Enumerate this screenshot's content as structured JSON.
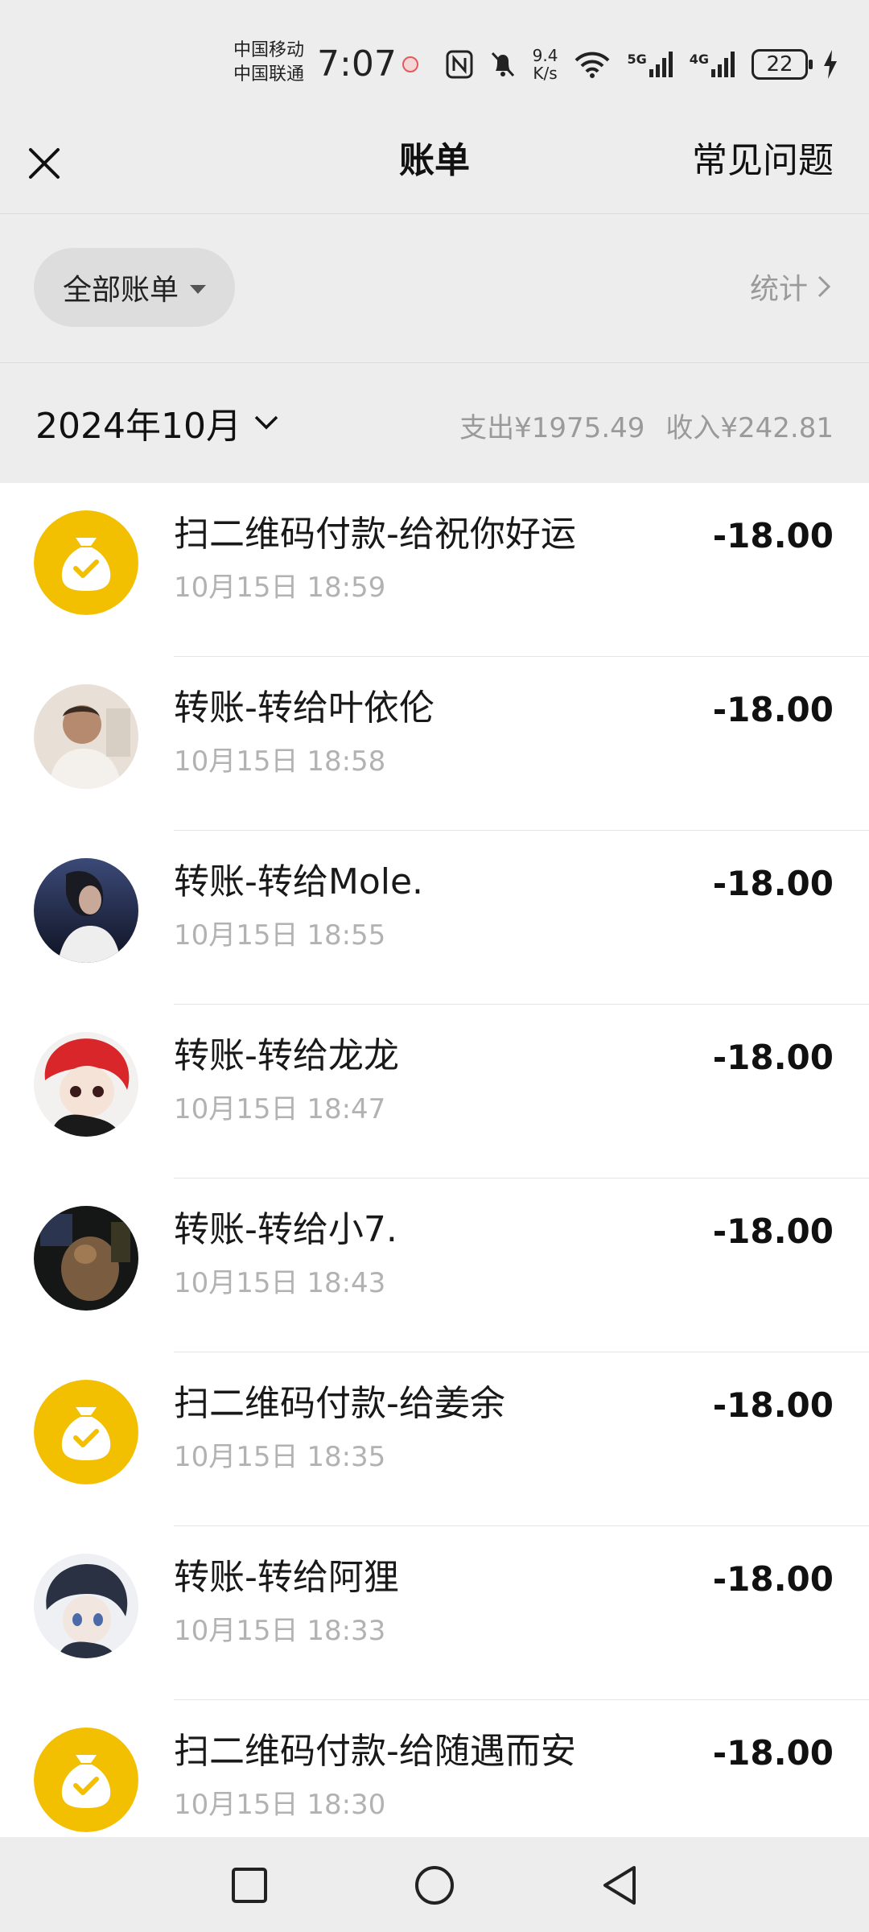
{
  "status_bar": {
    "carrier_1": "中国移动",
    "carrier_2": "中国联通",
    "time": "7:07",
    "net_speed_value": "9.4",
    "net_speed_unit": "K/s",
    "signal_1": "5G",
    "signal_2": "4G",
    "battery": "22"
  },
  "header": {
    "title": "账单",
    "faq": "常见问题"
  },
  "filter": {
    "label": "全部账单",
    "stats": "统计"
  },
  "month": {
    "label": "2024年10月",
    "expense": "支出¥1975.49",
    "income": "收入¥242.81"
  },
  "bills": [
    {
      "title": "扫二维码付款-给祝你好运",
      "time": "10月15日 18:59",
      "amount": "-18.00",
      "avatar": "qr-payment-icon"
    },
    {
      "title": "转账-转给叶依伦",
      "time": "10月15日 18:58",
      "amount": "-18.00",
      "avatar": "contact-avatar"
    },
    {
      "title": "转账-转给Mole.",
      "time": "10月15日 18:55",
      "amount": "-18.00",
      "avatar": "contact-avatar"
    },
    {
      "title": "转账-转给龙龙",
      "time": "10月15日 18:47",
      "amount": "-18.00",
      "avatar": "contact-avatar"
    },
    {
      "title": "转账-转给小7.",
      "time": "10月15日 18:43",
      "amount": "-18.00",
      "avatar": "contact-avatar"
    },
    {
      "title": "扫二维码付款-给姜余",
      "time": "10月15日 18:35",
      "amount": "-18.00",
      "avatar": "qr-payment-icon"
    },
    {
      "title": "转账-转给阿狸",
      "time": "10月15日 18:33",
      "amount": "-18.00",
      "avatar": "contact-avatar"
    },
    {
      "title": "扫二维码付款-给随遇而安",
      "time": "10月15日 18:30",
      "amount": "-18.00",
      "avatar": "qr-payment-icon"
    }
  ],
  "colors": {
    "background": "#ededed",
    "list_background": "#ffffff",
    "payment_yellow": "#f2c000",
    "secondary_text": "#9a9a9a"
  }
}
